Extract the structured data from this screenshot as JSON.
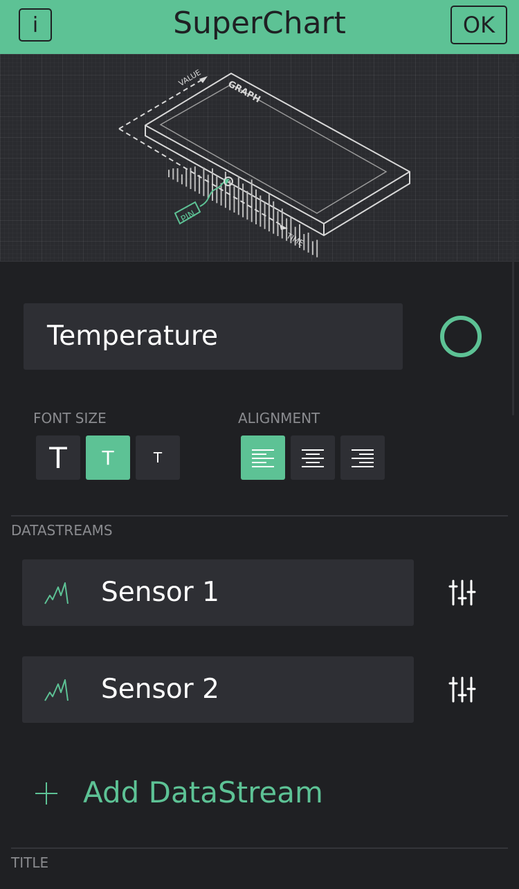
{
  "header": {
    "title": "SuperChart",
    "info_label": "i",
    "ok_label": "OK",
    "accent_color": "#5dc295"
  },
  "illustration": {
    "labels": [
      "VALUE",
      "GRAPH",
      "PIN",
      "TIME"
    ]
  },
  "widget": {
    "name_value": "Temperature",
    "color": "#5dc295"
  },
  "font_size": {
    "label": "FONT SIZE",
    "options": [
      "T",
      "T",
      "T"
    ],
    "selected_index": 1
  },
  "alignment": {
    "label": "ALIGNMENT",
    "options": [
      "left-align-icon",
      "center-align-icon",
      "right-align-icon"
    ],
    "selected_index": 0
  },
  "datastreams": {
    "label": "DATASTREAMS",
    "items": [
      {
        "label": "Sensor 1",
        "icon": "line-chart-icon"
      },
      {
        "label": "Sensor 2",
        "icon": "line-chart-icon"
      }
    ],
    "add_label": "Add DataStream"
  },
  "title_section": {
    "label": "TITLE"
  }
}
